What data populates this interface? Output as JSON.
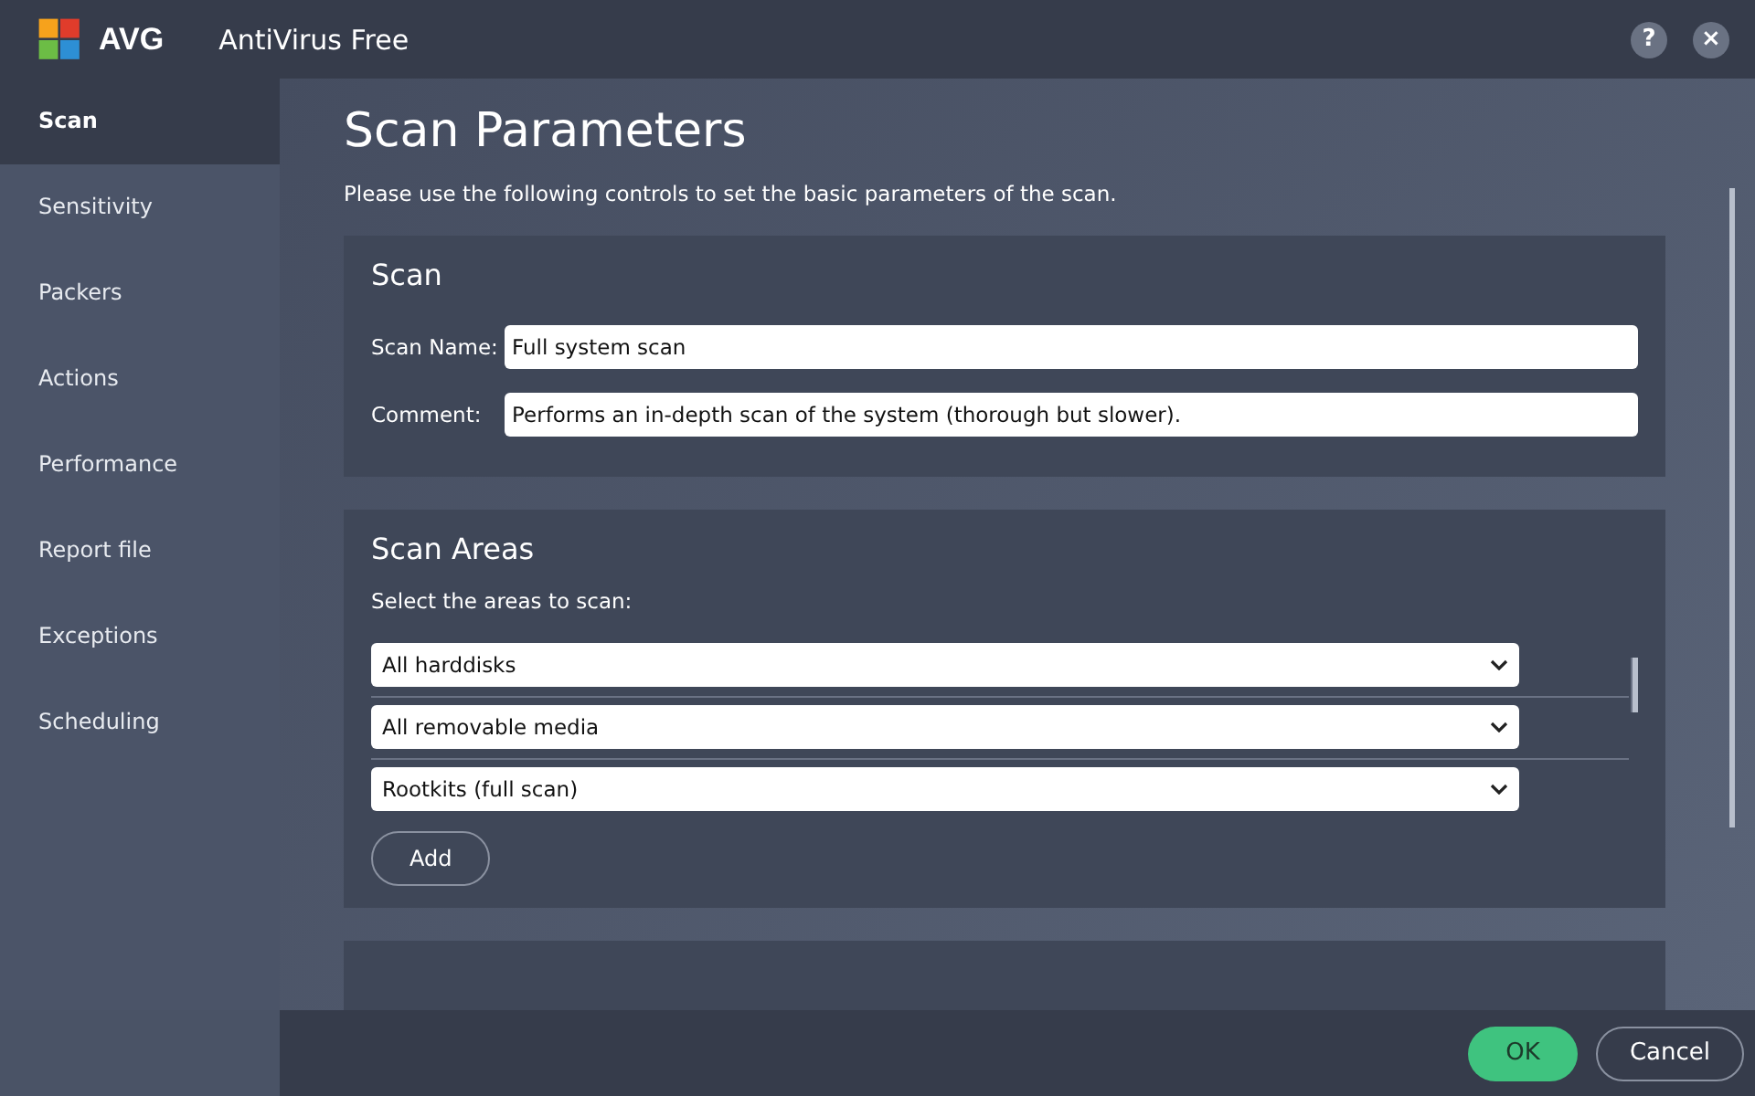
{
  "window": {
    "brand": "AVG",
    "title": "AntiVirus Free",
    "help": "?",
    "close": "×"
  },
  "sidebar": {
    "items": [
      {
        "label": "Scan",
        "selected": true
      },
      {
        "label": "Sensitivity",
        "selected": false
      },
      {
        "label": "Packers",
        "selected": false
      },
      {
        "label": "Actions",
        "selected": false
      },
      {
        "label": "Performance",
        "selected": false
      },
      {
        "label": "Report file",
        "selected": false
      },
      {
        "label": "Exceptions",
        "selected": false
      },
      {
        "label": "Scheduling",
        "selected": false
      }
    ]
  },
  "page": {
    "title": "Scan Parameters",
    "description": "Please use the following controls to set the basic parameters of the scan."
  },
  "scan_section": {
    "title": "Scan",
    "fields": [
      {
        "label": "Scan Name:",
        "value": "Full system scan"
      },
      {
        "label": "Comment:",
        "value": "Performs an in-depth scan of the system (thorough but slower)."
      }
    ]
  },
  "areas_section": {
    "title": "Scan Areas",
    "prompt": "Select the areas to scan:",
    "areas": [
      "All harddisks",
      "All removable media",
      "Rootkits (full scan)"
    ],
    "add_button": "Add"
  },
  "footer": {
    "ok": "OK",
    "cancel": "Cancel"
  }
}
